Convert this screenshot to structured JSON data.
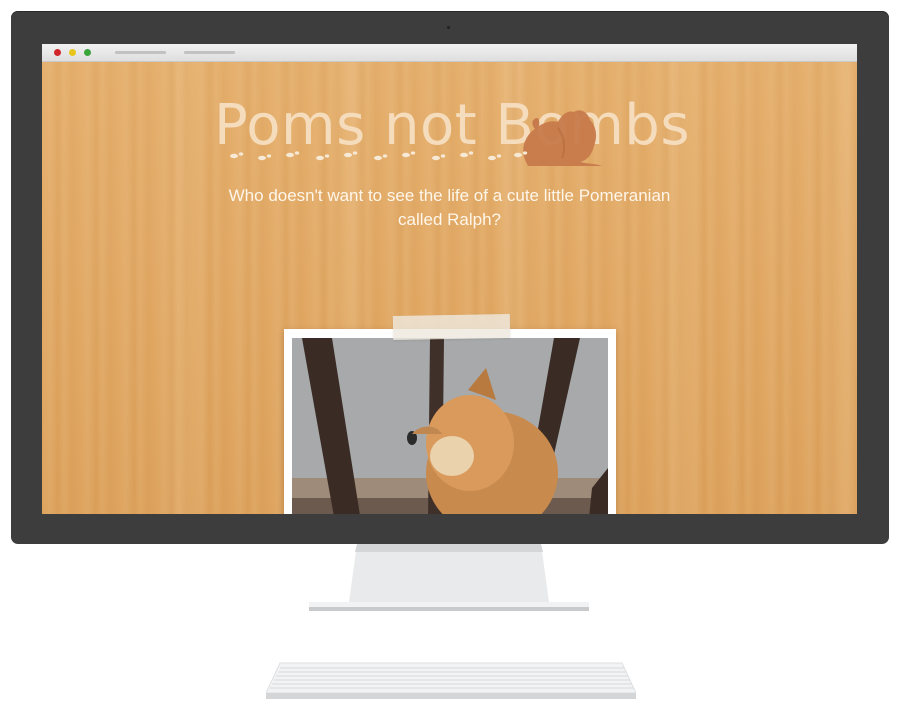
{
  "hero": {
    "title": "Poms not Bombs",
    "subtitle": "Who doesn't want to see the life of a cute little Pomeranian called Ralph?"
  },
  "icons": {
    "pom_logo": "pomeranian-silhouette-icon",
    "paw_trail": "paw-prints-icon",
    "photo": "pomeranian-behind-railing-photo"
  },
  "colors": {
    "wood": "#e2a862",
    "title": "#f4dcbc",
    "logo": "#c77a4b",
    "monitor": "#3d3d3d"
  }
}
